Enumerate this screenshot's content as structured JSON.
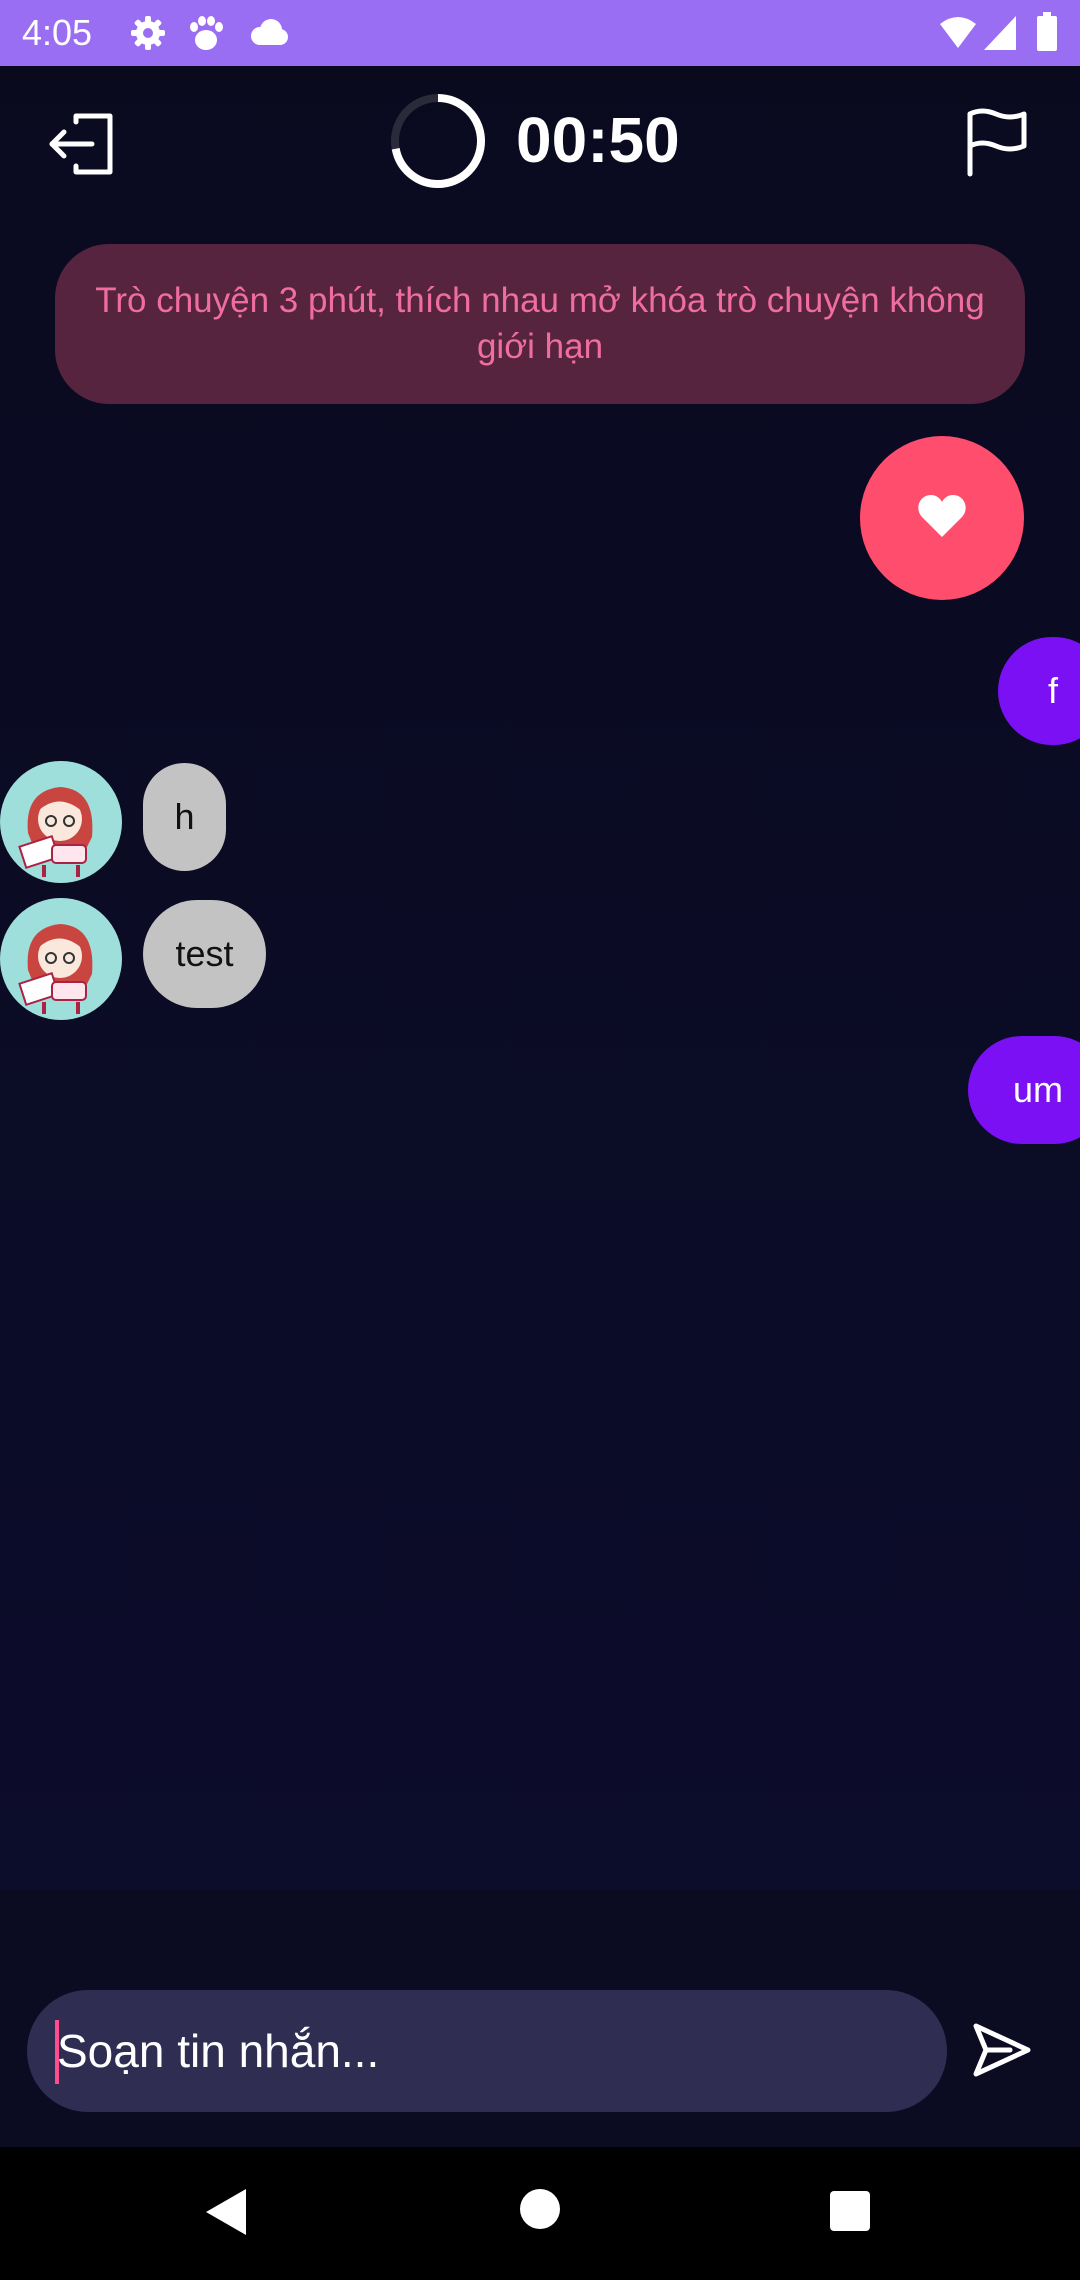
{
  "status_bar": {
    "time": "4:05",
    "icons": [
      "settings-icon",
      "paw-icon",
      "cloud-icon",
      "wifi-icon",
      "signal-icon",
      "battery-icon"
    ]
  },
  "header": {
    "timer": "00:50",
    "timer_progress": 0.72,
    "exit_icon": "exit-icon",
    "report_icon": "flag-icon"
  },
  "banner": {
    "text": "Trò chuyện 3 phút, thích nhau mở khóa trò chuyện không giới hạn"
  },
  "messages": [
    {
      "from": "me",
      "text": "f"
    },
    {
      "from": "partner",
      "text": "h"
    },
    {
      "from": "partner",
      "text": "test"
    },
    {
      "from": "me",
      "text": "um"
    }
  ],
  "composer": {
    "placeholder": "Soạn tin nhắn..."
  },
  "colors": {
    "status_bar": "#9a6ef3",
    "background": "#0b0b24",
    "banner_bg": "#56243f",
    "banner_text": "#f06da0",
    "like": "#ff4d6d",
    "sent_bubble": "#7b10f5",
    "received_bubble": "#c3c3c3",
    "input_bg": "#2f2d52"
  }
}
